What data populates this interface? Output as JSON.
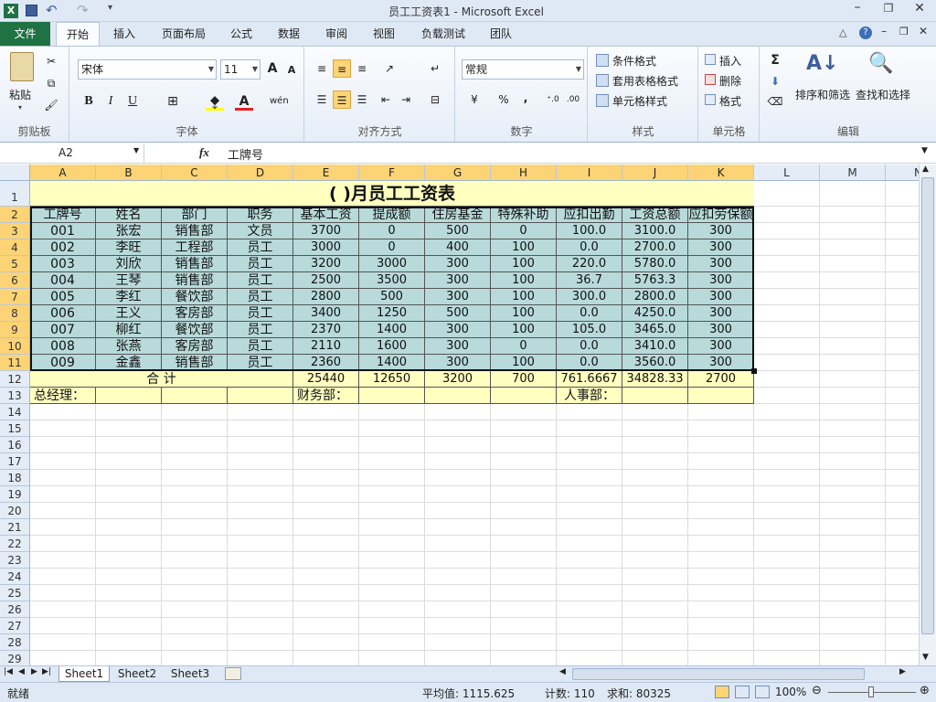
{
  "window": {
    "title": "员工工资表1 - Microsoft Excel",
    "app_icon": "excel-icon"
  },
  "tabs": [
    "文件",
    "开始",
    "插入",
    "页面布局",
    "公式",
    "数据",
    "审阅",
    "视图",
    "负载测试",
    "团队"
  ],
  "active_tab": "开始",
  "ribbon": {
    "clipboard": {
      "label": "剪贴板",
      "paste": "粘贴"
    },
    "font": {
      "label": "字体",
      "name": "宋体",
      "size": "11",
      "bold": "B",
      "italic": "I",
      "underline": "U",
      "grow": "A",
      "shrink": "A"
    },
    "alignment": {
      "label": "对齐方式"
    },
    "number": {
      "label": "数字",
      "format": "常规",
      "percent": "%",
      "comma": ","
    },
    "styles": {
      "label": "样式",
      "conditional": "条件格式",
      "table": "套用表格格式",
      "cell_styles": "单元格样式"
    },
    "cells": {
      "label": "单元格",
      "insert": "插入",
      "delete": "删除",
      "format": "格式"
    },
    "editing": {
      "label": "编辑",
      "sort": "排序和筛选",
      "find": "查找和选择",
      "sum": "Σ"
    }
  },
  "formula_bar": {
    "name_box": "A2",
    "fx": "fx",
    "value": "工牌号"
  },
  "columns": [
    "A",
    "B",
    "C",
    "D",
    "E",
    "F",
    "G",
    "H",
    "I",
    "J",
    "K",
    "L",
    "M",
    "N"
  ],
  "selected_columns": [
    "A",
    "B",
    "C",
    "D",
    "E",
    "F",
    "G",
    "H",
    "I",
    "J",
    "K"
  ],
  "rows": [
    "1",
    "2",
    "3",
    "4",
    "5",
    "6",
    "7",
    "8",
    "9",
    "10",
    "11",
    "12",
    "13",
    "14",
    "15",
    "16",
    "17",
    "18",
    "19",
    "20",
    "21",
    "22",
    "23",
    "24",
    "25",
    "26",
    "27",
    "28",
    "29"
  ],
  "sheet": {
    "title": "(  )月员工工资表",
    "headers": [
      "工牌号",
      "姓名",
      "部门",
      "职务",
      "基本工资",
      "提成额",
      "住房基金",
      "特殊补助",
      "应扣出勤",
      "工资总额",
      "应扣劳保额"
    ],
    "data": [
      [
        "001",
        "张宏",
        "销售部",
        "文员",
        "3700",
        "0",
        "500",
        "0",
        "100.0",
        "3100.0",
        "300"
      ],
      [
        "002",
        "李旺",
        "工程部",
        "员工",
        "3000",
        "0",
        "400",
        "100",
        "0.0",
        "2700.0",
        "300"
      ],
      [
        "003",
        "刘欣",
        "销售部",
        "员工",
        "3200",
        "3000",
        "300",
        "100",
        "220.0",
        "5780.0",
        "300"
      ],
      [
        "004",
        "王琴",
        "销售部",
        "员工",
        "2500",
        "3500",
        "300",
        "100",
        "36.7",
        "5763.3",
        "300"
      ],
      [
        "005",
        "李红",
        "餐饮部",
        "员工",
        "2800",
        "500",
        "300",
        "100",
        "300.0",
        "2800.0",
        "300"
      ],
      [
        "006",
        "王义",
        "客房部",
        "员工",
        "3400",
        "1250",
        "500",
        "100",
        "0.0",
        "4250.0",
        "300"
      ],
      [
        "007",
        "柳红",
        "餐饮部",
        "员工",
        "2370",
        "1400",
        "300",
        "100",
        "105.0",
        "3465.0",
        "300"
      ],
      [
        "008",
        "张燕",
        "客房部",
        "员工",
        "2110",
        "1600",
        "300",
        "0",
        "0.0",
        "3410.0",
        "300"
      ],
      [
        "009",
        "金鑫",
        "销售部",
        "员工",
        "2360",
        "1400",
        "300",
        "100",
        "0.0",
        "3560.0",
        "300"
      ]
    ],
    "total_label": "合  计",
    "totals": [
      "25440",
      "12650",
      "3200",
      "700",
      "761.6667",
      "34828.33",
      "2700"
    ],
    "footer": {
      "manager": "总经理：",
      "finance": "财务部：",
      "hr": "人事部："
    }
  },
  "sheet_tabs": [
    "Sheet1",
    "Sheet2",
    "Sheet3"
  ],
  "active_sheet": "Sheet1",
  "status": {
    "ready": "就绪",
    "average": "平均值: 1115.625",
    "count": "计数: 110",
    "sum": "求和: 80325",
    "zoom": "100%"
  },
  "colors": {
    "header_fill": "#b8dadb",
    "title_fill": "#ffffc0",
    "selection": "#fcd476",
    "excel_green": "#1f7244"
  }
}
